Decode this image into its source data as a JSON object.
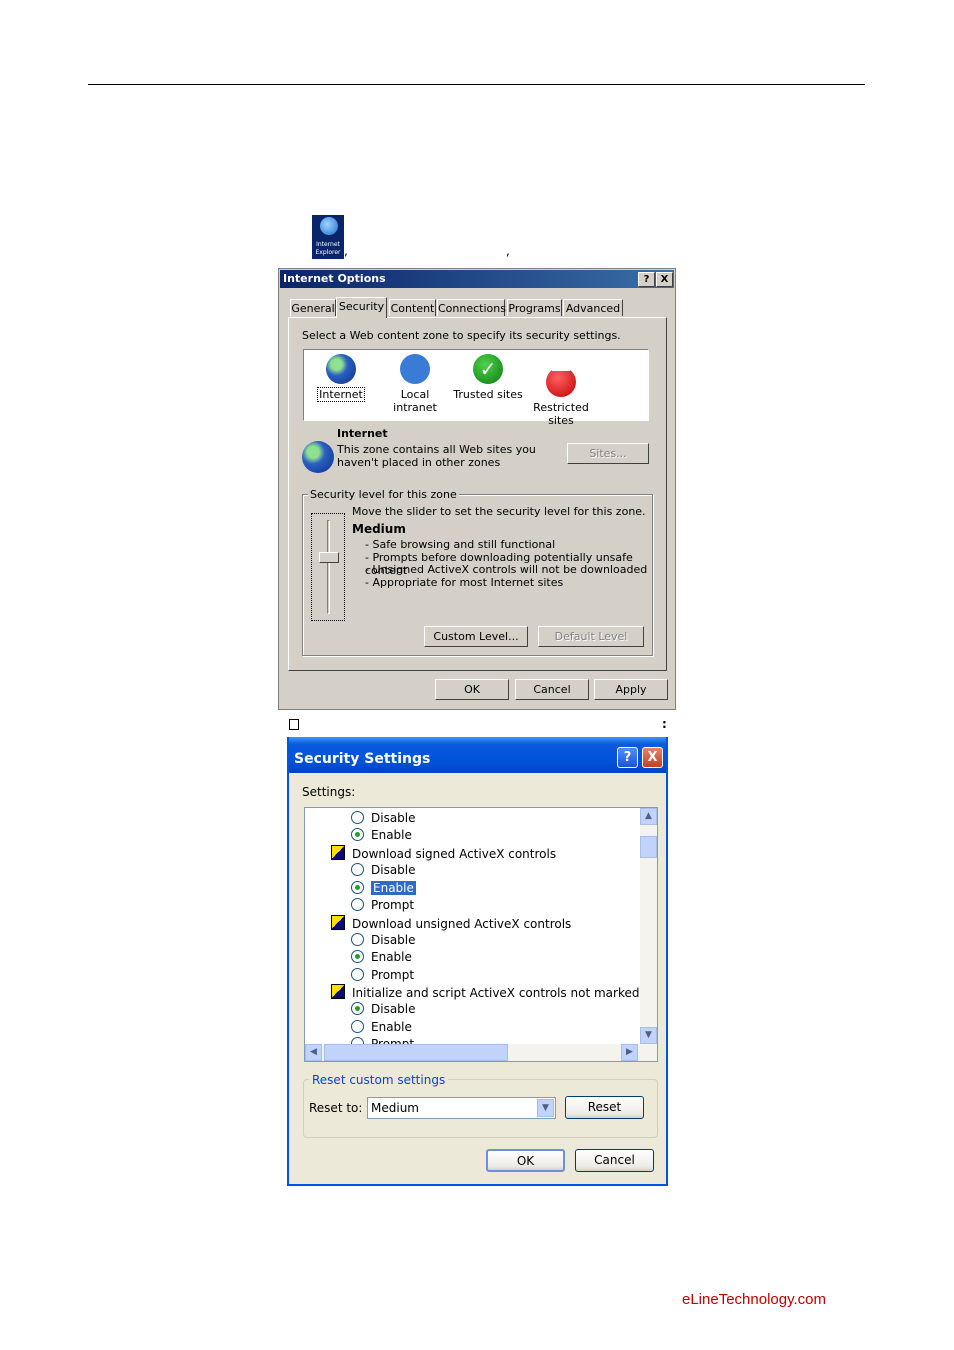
{
  "desktop_icon": {
    "label": "Internet Explorer"
  },
  "separators": {
    "comma": ",",
    "colon": ":"
  },
  "internet_options": {
    "title": "Internet Options",
    "help_btn": "?",
    "close_btn": "X",
    "tabs": [
      "General",
      "Security",
      "Content",
      "Connections",
      "Programs",
      "Advanced"
    ],
    "active_tab": "Security",
    "zone_prompt": "Select a Web content zone to specify its security settings.",
    "zones": [
      "Internet",
      "Local intranet",
      "Trusted sites",
      "Restricted sites"
    ],
    "zone_name": "Internet",
    "zone_desc_line1": "This zone contains all Web sites you",
    "zone_desc_line2": "haven't placed in other zones",
    "sites_button": "Sites...",
    "security_level_legend": "Security level for this zone",
    "slider_hint": "Move the slider to set the security level for this zone.",
    "level_name": "Medium",
    "level_points": [
      "- Safe browsing and still functional",
      "- Prompts before downloading potentially unsafe content",
      "- Unsigned ActiveX controls will not be downloaded",
      "- Appropriate for most Internet sites"
    ],
    "custom_level_button": "Custom Level...",
    "default_level_button": "Default Level",
    "ok_button": "OK",
    "cancel_button": "Cancel",
    "apply_button": "Apply"
  },
  "security_settings": {
    "title": "Security Settings",
    "help_btn": "?",
    "close_btn": "X",
    "settings_label": "Settings:",
    "items": [
      {
        "type": "radio",
        "label": "Disable",
        "checked": false
      },
      {
        "type": "radio",
        "label": "Enable",
        "checked": true
      },
      {
        "type": "header",
        "label": "Download signed ActiveX controls"
      },
      {
        "type": "radio",
        "label": "Disable",
        "checked": false
      },
      {
        "type": "radio",
        "label": "Enable",
        "checked": true,
        "selected": true
      },
      {
        "type": "radio",
        "label": "Prompt",
        "checked": false
      },
      {
        "type": "header",
        "label": "Download unsigned ActiveX controls"
      },
      {
        "type": "radio",
        "label": "Disable",
        "checked": false
      },
      {
        "type": "radio",
        "label": "Enable",
        "checked": true
      },
      {
        "type": "radio",
        "label": "Prompt",
        "checked": false
      },
      {
        "type": "header",
        "label": "Initialize and script ActiveX controls not marked as safe"
      },
      {
        "type": "radio",
        "label": "Disable",
        "checked": true
      },
      {
        "type": "radio",
        "label": "Enable",
        "checked": false
      },
      {
        "type": "radio",
        "label": "Prompt",
        "checked": false
      }
    ],
    "reset_group_legend": "Reset custom settings",
    "reset_to_label": "Reset to:",
    "reset_to_value": "Medium",
    "reset_button": "Reset",
    "ok_button": "OK",
    "cancel_button": "Cancel"
  },
  "footer": {
    "brand": "eLineTechnology.com"
  },
  "colors": {
    "xp_title": "#0252d9",
    "classic_title": "#0a246a",
    "footer": "#c00000",
    "selection": "#316ac5"
  }
}
